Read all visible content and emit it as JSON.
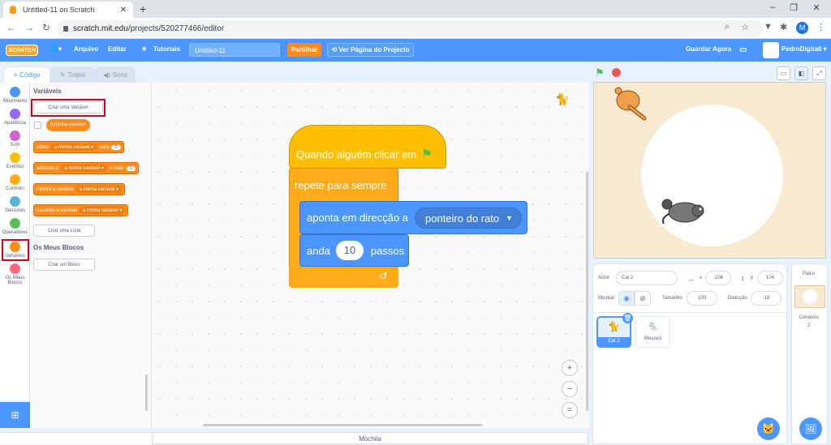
{
  "browser": {
    "tab_title": "Untitled-11 on Scratch",
    "url_host": "scratch.mit.edu",
    "url_path": "/projects/520277466/editor",
    "avatar_letter": "M"
  },
  "menu": {
    "logo": "SCRATCH",
    "file": "Arquivo",
    "edit": "Editar",
    "tutorials": "Tutoriais",
    "project_title": "Untitled-11",
    "share": "Partilhar",
    "see_project": "Ver Página do Projecto",
    "save_now": "Guardar Agora",
    "user": "PedroDigitall"
  },
  "tabs": {
    "code": "Código",
    "costumes": "Trajes",
    "sounds": "Sons"
  },
  "categories": [
    {
      "label": "Movimento",
      "color": "#4c97ff"
    },
    {
      "label": "Aparência",
      "color": "#9966ff"
    },
    {
      "label": "Som",
      "color": "#cf63cf"
    },
    {
      "label": "Eventos",
      "color": "#ffbf00"
    },
    {
      "label": "Controlo",
      "color": "#ffab19"
    },
    {
      "label": "Sensores",
      "color": "#5cb1d6"
    },
    {
      "label": "Operadores",
      "color": "#59c059"
    },
    {
      "label": "Variáveis",
      "color": "#ff8c1a"
    },
    {
      "label": "Os Meus Blocos",
      "color": "#ff6680"
    }
  ],
  "palette": {
    "variables_head": "Variáveis",
    "make_variable": "Criar uma Variável",
    "my_variable": "a minha variável",
    "set": {
      "t1": "altera",
      "var": "a minha variável",
      "t2": "para",
      "val": "0"
    },
    "change": {
      "t1": "adiciona a",
      "var": "a minha variável",
      "t2": "o valor",
      "val": "1"
    },
    "show": {
      "t1": "mostra a variável",
      "var": "a minha variável"
    },
    "hide": {
      "t1": "esconde a variável",
      "var": "a minha variável"
    },
    "make_list": "Criar uma Lista",
    "myblocks_head": "Os Meus Blocos",
    "make_block": "Criar um Bloco"
  },
  "script": {
    "hat": "Quando alguém clicar em",
    "forever": "repete para sempre",
    "point": "aponta em direcção a",
    "point_target": "ponteiro do rato",
    "move": "anda",
    "move_steps": "10",
    "move_unit": "passos"
  },
  "zoom": {
    "in": "+",
    "out": "−",
    "reset": "="
  },
  "backpack": "Mochila",
  "sprite": {
    "label": "Actor",
    "name": "Cat 2",
    "x_label": "x",
    "x": "-106",
    "y_label": "y",
    "y": "104",
    "show_label": "Mostrar",
    "size_label": "Tamanho",
    "size": "100",
    "direction_label": "Direcção",
    "direction": "-18"
  },
  "sprites": [
    {
      "name": "Cat 2"
    },
    {
      "name": "Mouse1"
    }
  ],
  "stage_panel": {
    "title": "Palco",
    "backdrops_label": "Cenários",
    "backdrops_count": "2"
  }
}
